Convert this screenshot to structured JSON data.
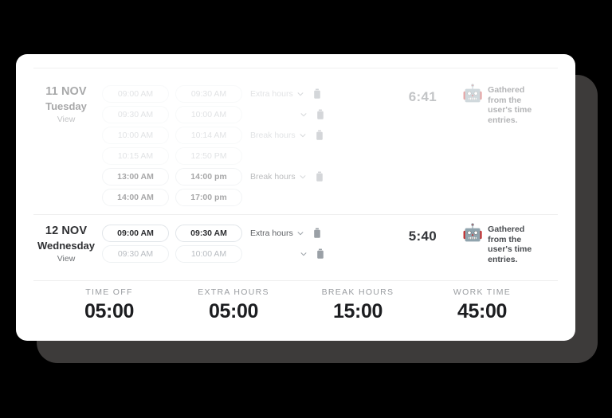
{
  "card": {
    "days": [
      {
        "date": "11 NOV",
        "weekday": "Tuesday",
        "view_label": "View",
        "faded": true,
        "total": "6:41",
        "note": "Gathered from the user's time entries.",
        "robot_icon": "robot-face-emoji",
        "entries": [
          {
            "start": "09:00 AM",
            "end": "09:30 AM",
            "tag": "Extra hours",
            "has_tag": true,
            "has_chevron": true,
            "has_delete": true,
            "emphasis": "dim"
          },
          {
            "start": "09:30 AM",
            "end": "10:00 AM",
            "tag": "",
            "has_tag": false,
            "has_chevron": true,
            "has_delete": true,
            "emphasis": "dim"
          },
          {
            "start": "10:00 AM",
            "end": "10:14 AM",
            "tag": "Break hours",
            "has_tag": true,
            "has_chevron": true,
            "has_delete": true,
            "emphasis": "dim"
          },
          {
            "start": "10:15 AM",
            "end": "12:50 PM",
            "tag": "",
            "has_tag": false,
            "has_chevron": false,
            "has_delete": false,
            "emphasis": "dim"
          },
          {
            "start": "13:00 AM",
            "end": "14:00 pm",
            "tag": "Break hours",
            "has_tag": true,
            "has_chevron": true,
            "has_delete": true,
            "emphasis": "strong"
          },
          {
            "start": "14:00 AM",
            "end": "17:00 pm",
            "tag": "",
            "has_tag": false,
            "has_chevron": false,
            "has_delete": false,
            "emphasis": "strong"
          }
        ]
      },
      {
        "date": "12 NOV",
        "weekday": "Wednesday",
        "view_label": "View",
        "faded": false,
        "total": "5:40",
        "note": "Gathered from the user's time entries.",
        "robot_icon": "robot-face-emoji",
        "entries": [
          {
            "start": "09:00 AM",
            "end": "09:30 AM",
            "tag": "Extra hours",
            "has_tag": true,
            "has_chevron": true,
            "has_delete": true,
            "emphasis": "strong"
          },
          {
            "start": "09:30 AM",
            "end": "10:00 AM",
            "tag": "",
            "has_tag": false,
            "has_chevron": true,
            "has_delete": true,
            "emphasis": "dim"
          }
        ]
      }
    ],
    "summary": [
      {
        "label": "TIME OFF",
        "value": "05:00"
      },
      {
        "label": "EXTRA HOURS",
        "value": "05:00"
      },
      {
        "label": "BREAK HOURS",
        "value": "15:00"
      },
      {
        "label": "WORK TIME",
        "value": "45:00"
      }
    ]
  },
  "colors": {
    "page_background": "#000000",
    "card_background": "#ffffff",
    "card_shadow": "#3d3b3a",
    "text_primary": "#2f3033",
    "text_muted": "#9a9da1",
    "pill_border": "#e6e9ec",
    "divider": "#efefef"
  }
}
